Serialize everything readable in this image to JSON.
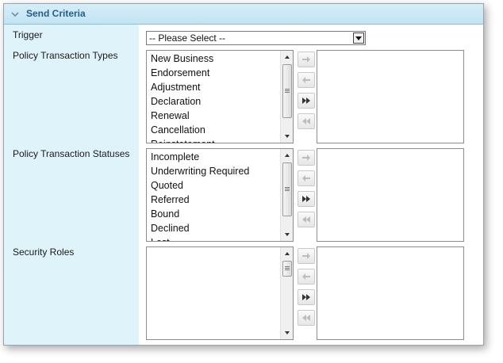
{
  "section": {
    "title": "Send Criteria"
  },
  "trigger": {
    "label": "Trigger",
    "selected": "-- Please Select --"
  },
  "policy_types": {
    "label": "Policy Transaction Types",
    "items": [
      "New Business",
      "Endorsement",
      "Adjustment",
      "Declaration",
      "Renewal",
      "Cancellation",
      "Reinstatement"
    ]
  },
  "policy_statuses": {
    "label": "Policy Transaction Statuses",
    "items": [
      "Incomplete",
      "Underwriting Required",
      "Quoted",
      "Referred",
      "Bound",
      "Declined",
      "Lost"
    ]
  },
  "security_roles": {
    "label": "Security Roles",
    "items": []
  }
}
